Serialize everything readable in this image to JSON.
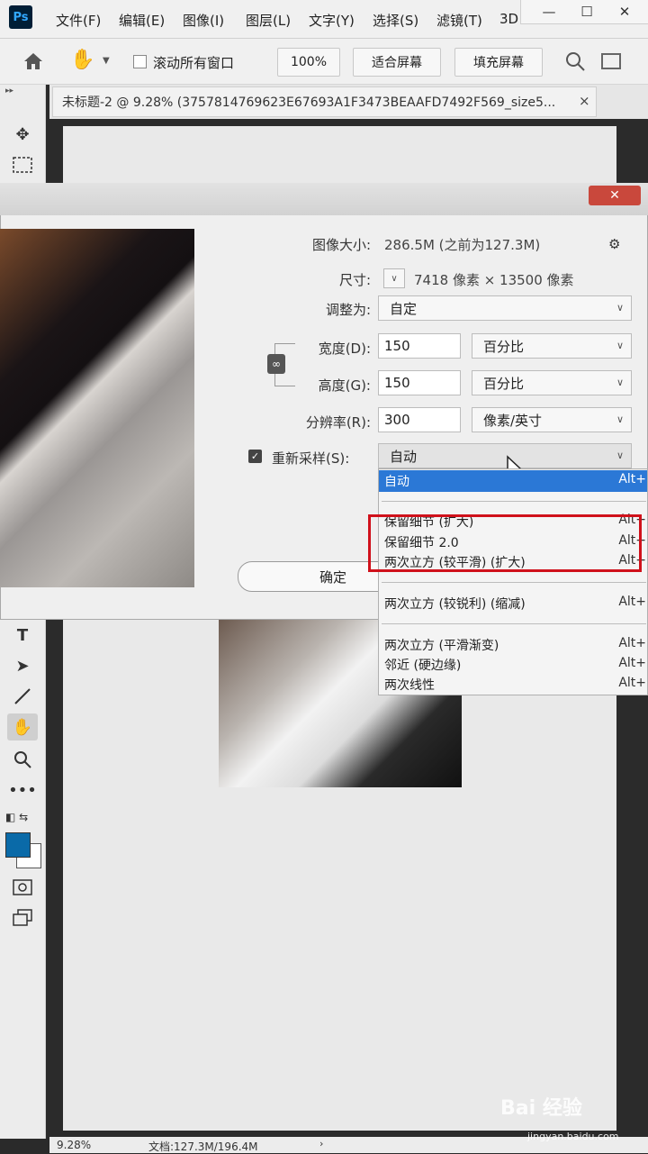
{
  "app": {
    "logo_text": "Ps"
  },
  "menu": {
    "items": [
      "文件(F)",
      "编辑(E)",
      "图像(I)",
      "图层(L)",
      "文字(Y)",
      "选择(S)",
      "滤镜(T)",
      "3D"
    ]
  },
  "window_controls": {
    "minimize": "—",
    "maximize": "☐",
    "close": "✕"
  },
  "options_bar": {
    "scroll_all_label": "滚动所有窗口",
    "scroll_all_checked": false,
    "zoom_button": "100%",
    "fit_screen_button": "适合屏幕",
    "fill_screen_button": "填充屏幕"
  },
  "document_tab": {
    "title": "未标题-2 @ 9.28% (3757814769623E67693A1F3473BEAAFD7492F569_size5...",
    "close": "×"
  },
  "dialog": {
    "close": "✕",
    "image_size_label": "图像大小:",
    "image_size_value": "286.5M (之前为127.3M)",
    "dimensions_label": "尺寸:",
    "dimensions_value": "7418 像素 × 13500 像素",
    "fit_to_label": "调整为:",
    "fit_to_value": "自定",
    "width_label": "宽度(D):",
    "width_value": "150",
    "width_unit": "百分比",
    "height_label": "高度(G):",
    "height_value": "150",
    "height_unit": "百分比",
    "resolution_label": "分辨率(R):",
    "resolution_value": "300",
    "resolution_unit": "像素/英寸",
    "resample_label": "重新采样(S):",
    "resample_checked": true,
    "resample_value": "自动",
    "ok_button": "确定"
  },
  "resample_dropdown": {
    "items": [
      {
        "label": "自动",
        "shortcut": "Alt+"
      },
      {
        "label": "保留细节 (扩大)",
        "shortcut": "Alt+"
      },
      {
        "label": "保留细节 2.0",
        "shortcut": "Alt+"
      },
      {
        "label": "两次立方 (较平滑) (扩大)",
        "shortcut": "Alt+"
      },
      {
        "label": "两次立方 (较锐利) (缩减)",
        "shortcut": "Alt+"
      },
      {
        "label": "两次立方 (平滑渐变)",
        "shortcut": "Alt+"
      },
      {
        "label": "邻近 (硬边缘)",
        "shortcut": "Alt+"
      },
      {
        "label": "两次线性",
        "shortcut": "Alt+"
      }
    ]
  },
  "status_bar": {
    "zoom": "9.28%",
    "doc_info": "文档:127.3M/196.4M"
  },
  "watermark": {
    "brand": "Bai 经验",
    "url": "jingyan.baidu.com"
  },
  "colors": {
    "highlight": "#d0111b",
    "foreground_swatch": "#0a6aa8",
    "selected_item": "#2b78d6"
  }
}
